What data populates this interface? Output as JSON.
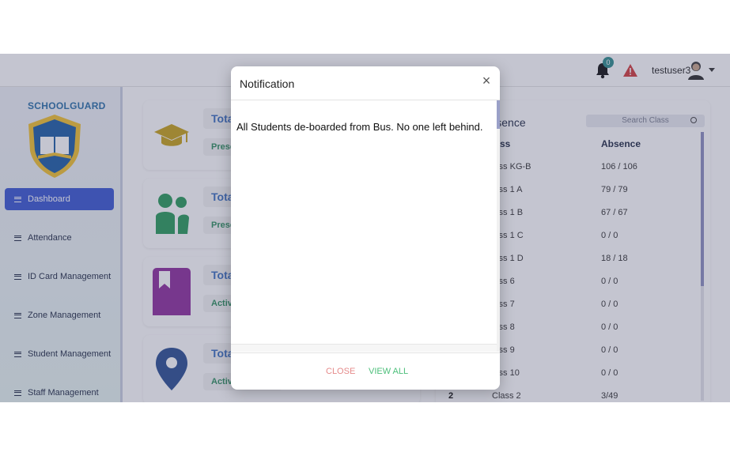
{
  "header": {
    "notification_count": "0",
    "username": "testuser3"
  },
  "sidebar": {
    "brand": "SCHOOLGUARD",
    "items": [
      {
        "label": "Dashboard"
      },
      {
        "label": "Attendance"
      },
      {
        "label": "ID Card Management"
      },
      {
        "label": "Zone Management"
      },
      {
        "label": "Student Management"
      },
      {
        "label": "Staff Management"
      }
    ]
  },
  "cards": [
    {
      "total": "Tota",
      "sub": "Prese",
      "icon": "graduation-cap-icon",
      "color": "#c8a21a"
    },
    {
      "total": "Tota",
      "sub": "Prese",
      "icon": "people-icon",
      "color": "#2a9b5a"
    },
    {
      "total": "Tota",
      "sub": "Activ",
      "icon": "bookmark-icon",
      "color": "#8e2f9c"
    },
    {
      "total": "Tota",
      "sub": "Activ",
      "icon": "location-pin-icon",
      "color": "#2b4f93"
    }
  ],
  "absence_panel": {
    "title": "s Wise Absence",
    "search_placeholder": "Search Class",
    "columns": [
      "lass",
      "Absence"
    ],
    "rows": [
      {
        "idx": "",
        "class": "lass KG-B",
        "absence": "106 / 106"
      },
      {
        "idx": "",
        "class": "lass 1 A",
        "absence": "79 / 79"
      },
      {
        "idx": "",
        "class": "lass 1 B",
        "absence": "67 / 67"
      },
      {
        "idx": "",
        "class": "lass 1 C",
        "absence": "0 / 0"
      },
      {
        "idx": "",
        "class": "lass 1 D",
        "absence": "18 / 18"
      },
      {
        "idx": "",
        "class": "lass 6",
        "absence": "0 / 0"
      },
      {
        "idx": "",
        "class": "lass 7",
        "absence": "0 / 0"
      },
      {
        "idx": "",
        "class": "lass 8",
        "absence": "0 / 0"
      },
      {
        "idx": "",
        "class": "lass 9",
        "absence": "0 / 0"
      },
      {
        "idx": "",
        "class": "lass 10",
        "absence": "0 / 0"
      },
      {
        "idx": "2",
        "class": "Class 2",
        "absence": "3/49"
      }
    ]
  },
  "modal": {
    "title": "Notification",
    "message": "All Students de-boarded from Bus. No one left behind.",
    "close_label": "CLOSE",
    "view_all_label": "VIEW ALL"
  },
  "colors": {
    "accent": "#3a57d2",
    "close_btn": "#e58a8a",
    "view_all_btn": "#4cbf7a"
  }
}
